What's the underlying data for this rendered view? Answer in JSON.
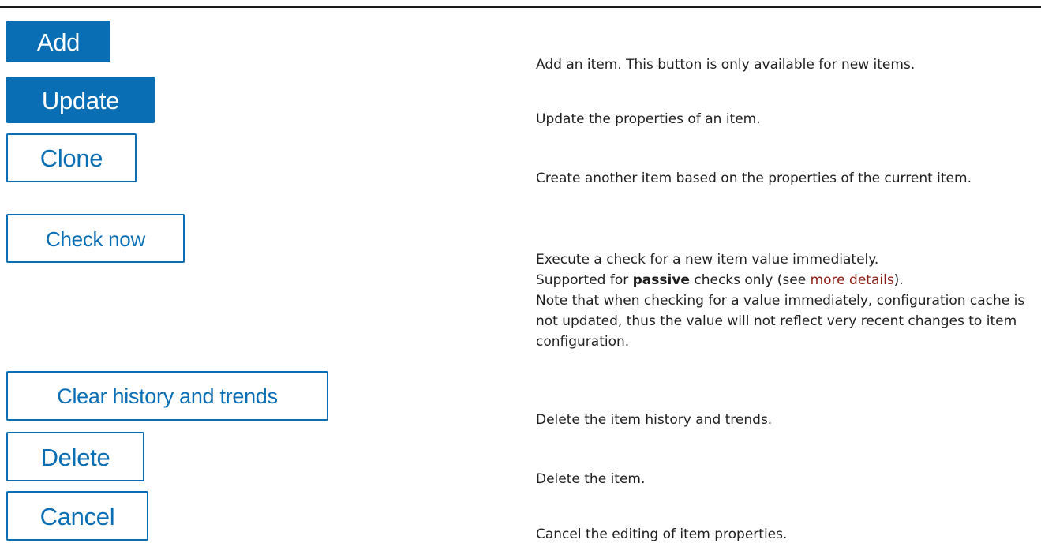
{
  "buttons": {
    "add": "Add",
    "update": "Update",
    "clone": "Clone",
    "check_now": "Check now",
    "clear_history": "Clear history and trends",
    "delete": "Delete",
    "cancel": "Cancel"
  },
  "descriptions": {
    "add": "Add an item. This button is only available for new items.",
    "update": "Update the properties of an item.",
    "clone": "Create another item based on the properties of the current item.",
    "check_now": {
      "line1": "Execute a check for a new item value immediately.",
      "line2_pre": "Supported for ",
      "line2_bold": "passive",
      "line2_mid": " checks only (see ",
      "line2_link": "more details",
      "line2_post": ").",
      "rest": "Note that when checking for a value immediately, configuration cache is not updated, thus the value will not reflect very recent changes to item configuration."
    },
    "clear_history": "Delete the item history and trends.",
    "delete": "Delete the item.",
    "cancel": "Cancel the editing of item properties."
  },
  "colors": {
    "button_blue": "#0a6eb4",
    "link": "#8c1c13"
  }
}
